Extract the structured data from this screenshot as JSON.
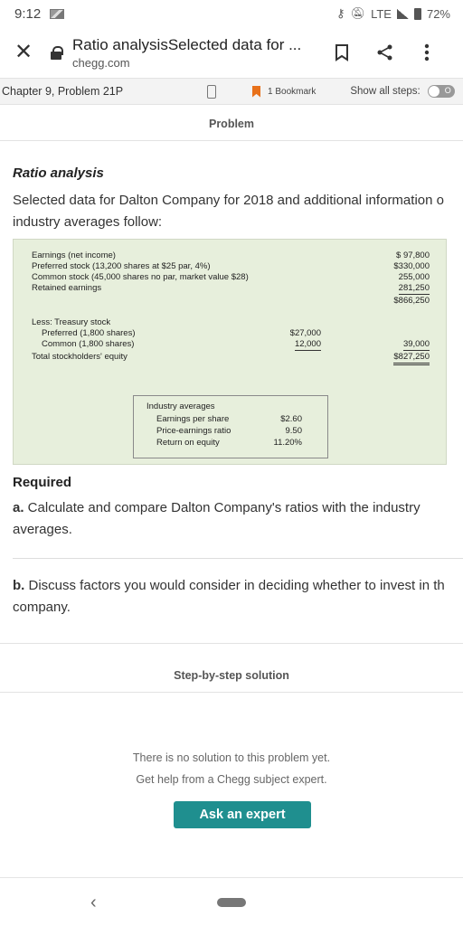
{
  "status_bar": {
    "time": "9:12",
    "network": "LTE",
    "battery": "72%"
  },
  "browser": {
    "title": "Ratio analysisSelected data for ...",
    "domain": "chegg.com"
  },
  "chegg_toolbar": {
    "chapter": "Chapter 9, Problem 21P",
    "bookmark_count": "1 Bookmark",
    "show_steps": "Show all steps:",
    "toggle_label": "O"
  },
  "problem": {
    "section_label": "Problem",
    "title": "Ratio analysis",
    "intro_line1": "Selected data for Dalton Company for 2018 and additional information o",
    "intro_line2": "industry averages follow:",
    "table": {
      "rows": [
        {
          "label": "Earnings (net income)",
          "mid": "",
          "amount": "$ 97,800"
        },
        {
          "label": "Preferred stock (13,200 shares at $25 par, 4%)",
          "mid": "",
          "amount": "$330,000"
        },
        {
          "label": "Common stock (45,000 shares no par, market value $28)",
          "mid": "",
          "amount": "255,000"
        },
        {
          "label": "Retained earnings",
          "mid": "",
          "amount": "281,250"
        },
        {
          "label": "",
          "mid": "",
          "amount": "$866,250"
        },
        {
          "label": "Less: Treasury stock",
          "mid": "",
          "amount": ""
        },
        {
          "label": "Preferred (1,800 shares)",
          "mid": "$27,000",
          "amount": ""
        },
        {
          "label": "Common (1,800 shares)",
          "mid": "12,000",
          "amount": "39,000"
        },
        {
          "label": "Total stockholders' equity",
          "mid": "",
          "amount": "$827,250"
        }
      ],
      "industry_title": "Industry averages",
      "industry_rows": [
        {
          "label": "Earnings per share",
          "amount": "$2.60"
        },
        {
          "label": "Price-earnings ratio",
          "amount": "9.50"
        },
        {
          "label": "Return on equity",
          "amount": "11.20%"
        }
      ]
    },
    "required_label": "Required",
    "part_a_bold": "a.",
    "part_a_text": " Calculate and compare Dalton Company's ratios with the industry averages.",
    "part_b_bold": "b.",
    "part_b_text": " Discuss factors you would consider in deciding whether to invest in th company."
  },
  "solution": {
    "section_label": "Step-by-step solution",
    "no_solution_line1": "There is no solution to this problem yet.",
    "no_solution_line2": "Get help from a Chegg subject expert.",
    "ask_button": "Ask an expert"
  },
  "colors": {
    "accent": "#1f8f8f",
    "flag": "#e8711a",
    "table_bg": "#e7efdc"
  }
}
